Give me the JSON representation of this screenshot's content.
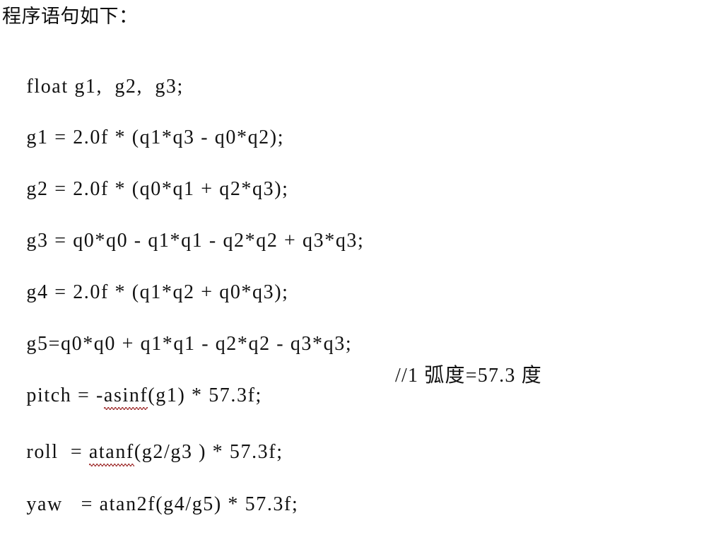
{
  "document": {
    "background_color": "#ffffff",
    "text_color": "#111111",
    "spellcheck_underline_color": "#9e2b2b",
    "heading": "程序语句如下：",
    "lines": [
      {
        "id": "declaration",
        "text": "float g1,  g2,  g3;"
      },
      {
        "id": "g1-assignment",
        "text": "g1 = 2.0f * (q1*q3 - q0*q2);"
      },
      {
        "id": "g2-assignment",
        "text": "g2 = 2.0f * (q0*q1 + q2*q3);"
      },
      {
        "id": "g3-assignment",
        "text": "g3 = q0*q0 - q1*q1 - q2*q2 + q3*q3;"
      },
      {
        "id": "g4-assignment",
        "text": "g4 = 2.0f * (q1*q2 + q0*q3);"
      },
      {
        "id": "g5-assignment",
        "text": "g5=q0*q0 + q1*q1 - q2*q2 - q3*q3;"
      }
    ],
    "pitch_line": {
      "prefix": "pitch = -",
      "misspelled": "asinf",
      "suffix": "(g1) * 57.3f;",
      "comment": "//1 弧度=57.3 度"
    },
    "roll_line": {
      "prefix": "roll  = ",
      "misspelled": "atanf",
      "suffix": "(g2/g3 ) * 57.3f;"
    },
    "yaw_line": {
      "text": "yaw   = atan2f(g4/g5) * 57.3f;"
    }
  }
}
